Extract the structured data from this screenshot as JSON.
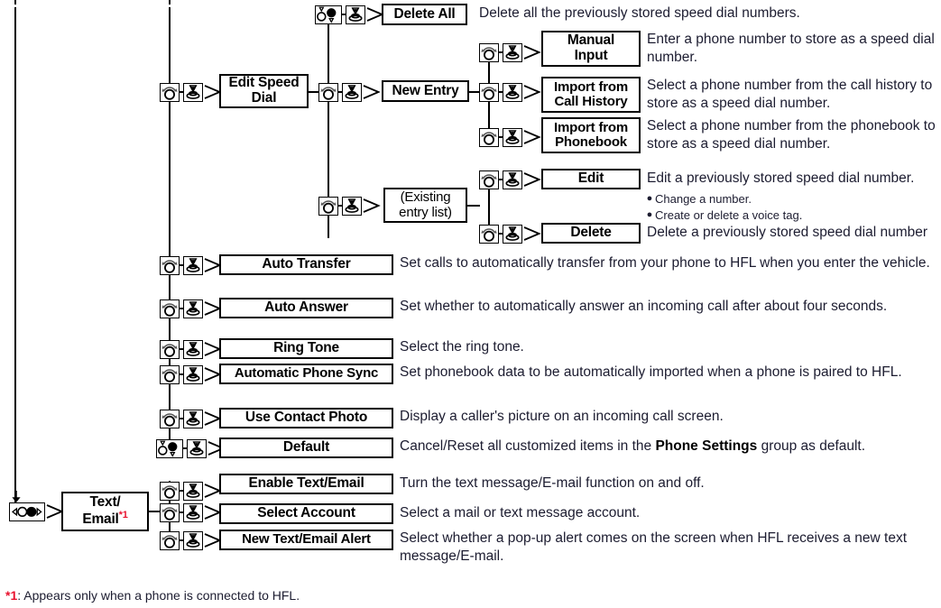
{
  "document": {
    "type": "menu-tree-diagram",
    "title": "Phone Settings / Text Email menu tree"
  },
  "icons": {
    "rotary_knob": "rotary-selector-knob-icon",
    "press_knob": "press-enter-knob-icon",
    "updown_knob": "up-down-selector-knob-icon",
    "leftright_knob": "left-right-selector-knob-icon",
    "arrow": "arrow-right-icon"
  },
  "nodes": {
    "delete_all": "Delete All",
    "edit_speed_dial": "Edit Speed\nDial",
    "new_entry": "New Entry",
    "manual_input": "Manual\nInput",
    "import_call_history": "Import from\nCall History",
    "import_phonebook": "Import from\nPhonebook",
    "existing_entry_list": "(Existing\nentry list)",
    "edit": "Edit",
    "delete": "Delete",
    "auto_transfer": "Auto Transfer",
    "auto_answer": "Auto Answer",
    "ring_tone": "Ring Tone",
    "automatic_phone_sync": "Automatic Phone Sync",
    "use_contact_photo": "Use Contact Photo",
    "default": "Default",
    "text_email": "Text/\nEmail",
    "text_email_footnote_marker": "*1",
    "enable_text_email": "Enable Text/Email",
    "select_account": "Select Account",
    "new_text_email_alert": "New Text/Email Alert"
  },
  "descriptions": {
    "delete_all": "Delete all the previously stored speed dial numbers.",
    "manual_input": "Enter a phone number to store as a speed dial number.",
    "import_call_history": "Select a phone number from the call history to store as a speed dial number.",
    "import_phonebook": "Select a phone number from the phonebook to store as a speed dial number.",
    "edit": "Edit a previously stored speed dial number.",
    "edit_bullets": [
      "Change a number.",
      "Create or delete a voice tag."
    ],
    "delete": "Delete a previously stored speed dial number",
    "auto_transfer": "Set calls to automatically transfer from your phone to HFL when you enter the vehicle.",
    "auto_answer": "Set whether to automatically answer an incoming call after about four seconds.",
    "ring_tone": "Select the ring tone.",
    "automatic_phone_sync": "Set phonebook data to be automatically imported when a phone is paired to HFL.",
    "use_contact_photo": "Display a caller's picture on an incoming call screen.",
    "default_prefix": "Cancel/Reset all customized items in the ",
    "default_bold": "Phone Settings",
    "default_suffix": " group as default.",
    "enable_text_email": "Turn the text message/E-mail function on and off.",
    "select_account": "Select a mail or text message account.",
    "new_text_email_alert": "Select whether a pop-up alert comes on the screen when HFL receives a new text message/E-mail."
  },
  "footnote": {
    "marker": "*1",
    "separator": ": ",
    "text": "Appears only when a phone is connected to HFL."
  },
  "colors": {
    "line": "#000000",
    "text": "#1c1c30",
    "accent_red": "#e8112d",
    "background": "#ffffff"
  }
}
